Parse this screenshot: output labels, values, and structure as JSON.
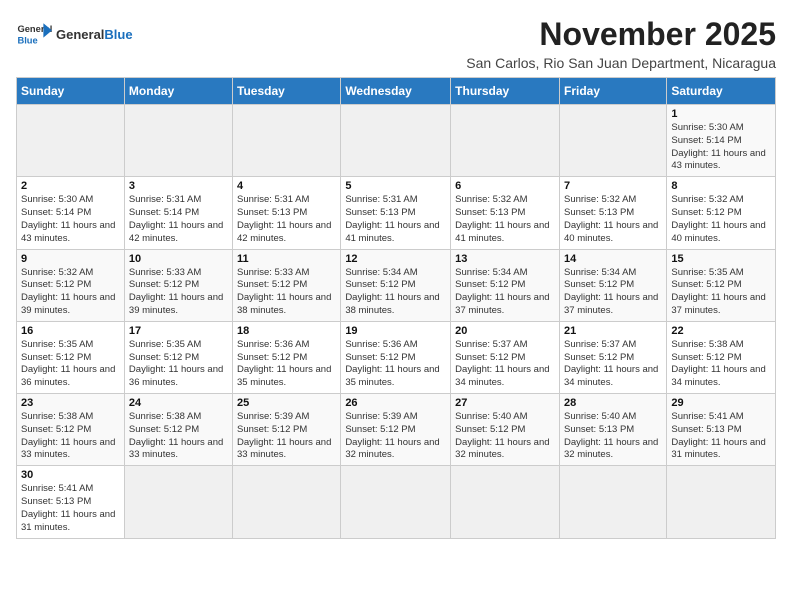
{
  "header": {
    "logo_general": "General",
    "logo_blue": "Blue",
    "month_title": "November 2025",
    "subtitle": "San Carlos, Rio San Juan Department, Nicaragua"
  },
  "weekdays": [
    "Sunday",
    "Monday",
    "Tuesday",
    "Wednesday",
    "Thursday",
    "Friday",
    "Saturday"
  ],
  "weeks": [
    [
      {
        "day": "",
        "info": ""
      },
      {
        "day": "",
        "info": ""
      },
      {
        "day": "",
        "info": ""
      },
      {
        "day": "",
        "info": ""
      },
      {
        "day": "",
        "info": ""
      },
      {
        "day": "",
        "info": ""
      },
      {
        "day": "1",
        "info": "Sunrise: 5:30 AM\nSunset: 5:14 PM\nDaylight: 11 hours\nand 43 minutes."
      }
    ],
    [
      {
        "day": "2",
        "info": "Sunrise: 5:30 AM\nSunset: 5:14 PM\nDaylight: 11 hours\nand 43 minutes."
      },
      {
        "day": "3",
        "info": "Sunrise: 5:31 AM\nSunset: 5:14 PM\nDaylight: 11 hours\nand 42 minutes."
      },
      {
        "day": "4",
        "info": "Sunrise: 5:31 AM\nSunset: 5:13 PM\nDaylight: 11 hours\nand 42 minutes."
      },
      {
        "day": "5",
        "info": "Sunrise: 5:31 AM\nSunset: 5:13 PM\nDaylight: 11 hours\nand 41 minutes."
      },
      {
        "day": "6",
        "info": "Sunrise: 5:32 AM\nSunset: 5:13 PM\nDaylight: 11 hours\nand 41 minutes."
      },
      {
        "day": "7",
        "info": "Sunrise: 5:32 AM\nSunset: 5:13 PM\nDaylight: 11 hours\nand 40 minutes."
      },
      {
        "day": "8",
        "info": "Sunrise: 5:32 AM\nSunset: 5:12 PM\nDaylight: 11 hours\nand 40 minutes."
      }
    ],
    [
      {
        "day": "9",
        "info": "Sunrise: 5:32 AM\nSunset: 5:12 PM\nDaylight: 11 hours\nand 39 minutes."
      },
      {
        "day": "10",
        "info": "Sunrise: 5:33 AM\nSunset: 5:12 PM\nDaylight: 11 hours\nand 39 minutes."
      },
      {
        "day": "11",
        "info": "Sunrise: 5:33 AM\nSunset: 5:12 PM\nDaylight: 11 hours\nand 38 minutes."
      },
      {
        "day": "12",
        "info": "Sunrise: 5:34 AM\nSunset: 5:12 PM\nDaylight: 11 hours\nand 38 minutes."
      },
      {
        "day": "13",
        "info": "Sunrise: 5:34 AM\nSunset: 5:12 PM\nDaylight: 11 hours\nand 37 minutes."
      },
      {
        "day": "14",
        "info": "Sunrise: 5:34 AM\nSunset: 5:12 PM\nDaylight: 11 hours\nand 37 minutes."
      },
      {
        "day": "15",
        "info": "Sunrise: 5:35 AM\nSunset: 5:12 PM\nDaylight: 11 hours\nand 37 minutes."
      }
    ],
    [
      {
        "day": "16",
        "info": "Sunrise: 5:35 AM\nSunset: 5:12 PM\nDaylight: 11 hours\nand 36 minutes."
      },
      {
        "day": "17",
        "info": "Sunrise: 5:35 AM\nSunset: 5:12 PM\nDaylight: 11 hours\nand 36 minutes."
      },
      {
        "day": "18",
        "info": "Sunrise: 5:36 AM\nSunset: 5:12 PM\nDaylight: 11 hours\nand 35 minutes."
      },
      {
        "day": "19",
        "info": "Sunrise: 5:36 AM\nSunset: 5:12 PM\nDaylight: 11 hours\nand 35 minutes."
      },
      {
        "day": "20",
        "info": "Sunrise: 5:37 AM\nSunset: 5:12 PM\nDaylight: 11 hours\nand 34 minutes."
      },
      {
        "day": "21",
        "info": "Sunrise: 5:37 AM\nSunset: 5:12 PM\nDaylight: 11 hours\nand 34 minutes."
      },
      {
        "day": "22",
        "info": "Sunrise: 5:38 AM\nSunset: 5:12 PM\nDaylight: 11 hours\nand 34 minutes."
      }
    ],
    [
      {
        "day": "23",
        "info": "Sunrise: 5:38 AM\nSunset: 5:12 PM\nDaylight: 11 hours\nand 33 minutes."
      },
      {
        "day": "24",
        "info": "Sunrise: 5:38 AM\nSunset: 5:12 PM\nDaylight: 11 hours\nand 33 minutes."
      },
      {
        "day": "25",
        "info": "Sunrise: 5:39 AM\nSunset: 5:12 PM\nDaylight: 11 hours\nand 33 minutes."
      },
      {
        "day": "26",
        "info": "Sunrise: 5:39 AM\nSunset: 5:12 PM\nDaylight: 11 hours\nand 32 minutes."
      },
      {
        "day": "27",
        "info": "Sunrise: 5:40 AM\nSunset: 5:12 PM\nDaylight: 11 hours\nand 32 minutes."
      },
      {
        "day": "28",
        "info": "Sunrise: 5:40 AM\nSunset: 5:13 PM\nDaylight: 11 hours\nand 32 minutes."
      },
      {
        "day": "29",
        "info": "Sunrise: 5:41 AM\nSunset: 5:13 PM\nDaylight: 11 hours\nand 31 minutes."
      }
    ],
    [
      {
        "day": "30",
        "info": "Sunrise: 5:41 AM\nSunset: 5:13 PM\nDaylight: 11 hours\nand 31 minutes."
      },
      {
        "day": "",
        "info": ""
      },
      {
        "day": "",
        "info": ""
      },
      {
        "day": "",
        "info": ""
      },
      {
        "day": "",
        "info": ""
      },
      {
        "day": "",
        "info": ""
      },
      {
        "day": "",
        "info": ""
      }
    ]
  ]
}
